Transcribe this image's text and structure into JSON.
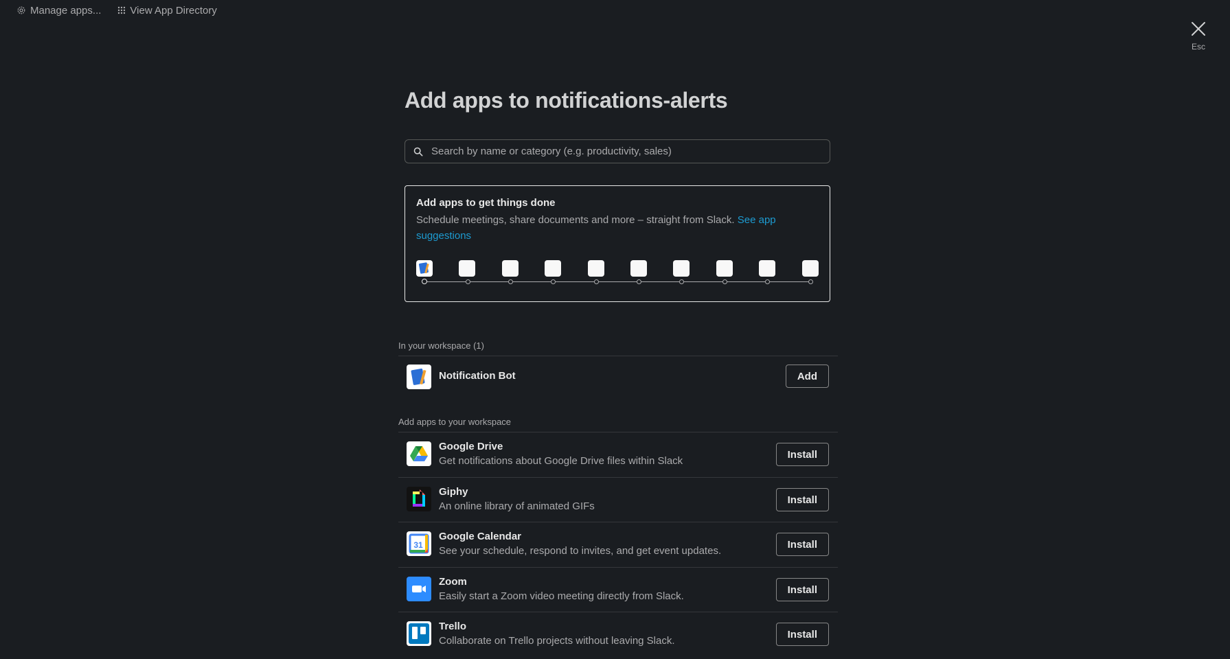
{
  "topbar": {
    "manage_label": "Manage apps...",
    "directory_label": "View App Directory"
  },
  "close": {
    "label": "Esc"
  },
  "title": "Add apps to notifications-alerts",
  "search": {
    "placeholder": "Search by name or category (e.g. productivity, sales)"
  },
  "card": {
    "title": "Add apps to get things done",
    "description": "Schedule meetings, share documents and more – straight from Slack.",
    "link": "See app suggestions"
  },
  "workspace": {
    "label": "In your workspace (1)",
    "apps": [
      {
        "name": "Notification Bot",
        "button": "Add"
      }
    ]
  },
  "install": {
    "label": "Add apps to your workspace",
    "apps": [
      {
        "name": "Google Drive",
        "description": "Get notifications about Google Drive files within Slack",
        "button": "Install"
      },
      {
        "name": "Giphy",
        "description": "An online library of animated GIFs",
        "button": "Install"
      },
      {
        "name": "Google Calendar",
        "description": "See your schedule, respond to invites, and get event updates.",
        "button": "Install"
      },
      {
        "name": "Zoom",
        "description": "Easily start a Zoom video meeting directly from Slack.",
        "button": "Install"
      },
      {
        "name": "Trello",
        "description": "Collaborate on Trello projects without leaving Slack.",
        "button": "Install"
      }
    ]
  },
  "colors": {
    "background": "#1a1d21",
    "link": "#1d9bd1",
    "text": "#d1d2d3"
  }
}
